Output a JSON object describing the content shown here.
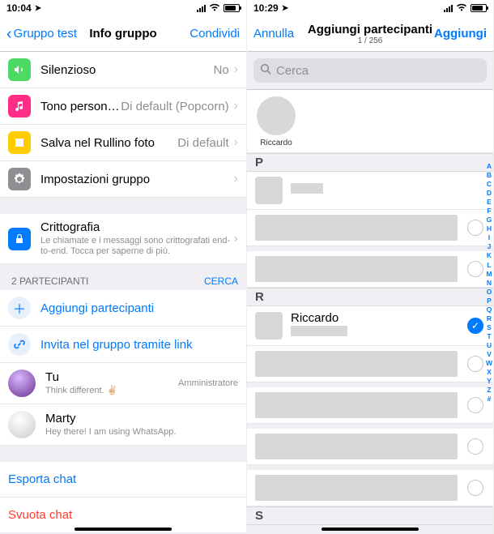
{
  "left": {
    "time": "10:04",
    "nav": {
      "back": "Gruppo test",
      "title": "Info gruppo",
      "action": "Condividi"
    },
    "rows": {
      "silent": {
        "label": "Silenzioso",
        "value": "No"
      },
      "tone": {
        "label": "Tono personalizza…",
        "value": "Di default (Popcorn)"
      },
      "save": {
        "label": "Salva nel Rullino foto",
        "value": "Di default"
      },
      "settings": {
        "label": "Impostazioni gruppo"
      },
      "crypto": {
        "label": "Crittografia",
        "sub": "Le chiamate e i messaggi sono crittografati end-to-end. Tocca per saperne di più."
      }
    },
    "participants": {
      "header": "2 PARTECIPANTI",
      "search": "CERCA",
      "add": "Aggiungi partecipanti",
      "invite": "Invita nel gruppo tramite link",
      "you": {
        "name": "Tu",
        "status": "Think different. ✌🏻",
        "role": "Amministratore"
      },
      "marty": {
        "name": "Marty",
        "status": "Hey there! I am using WhatsApp."
      }
    },
    "actions": {
      "export": "Esporta chat",
      "clear": "Svuota chat"
    }
  },
  "right": {
    "time": "10:29",
    "nav": {
      "cancel": "Annulla",
      "title": "Aggiungi partecipanti",
      "count": "1 / 256",
      "add": "Aggiungi"
    },
    "search_placeholder": "Cerca",
    "selected_name": "Riccardo",
    "letters": {
      "p": "P",
      "r": "R",
      "s": "S"
    },
    "riccardo": "Riccardo",
    "index": [
      "A",
      "B",
      "C",
      "D",
      "E",
      "F",
      "G",
      "H",
      "I",
      "J",
      "K",
      "L",
      "M",
      "N",
      "O",
      "P",
      "Q",
      "R",
      "S",
      "T",
      "U",
      "V",
      "W",
      "X",
      "Y",
      "Z",
      "#"
    ]
  }
}
